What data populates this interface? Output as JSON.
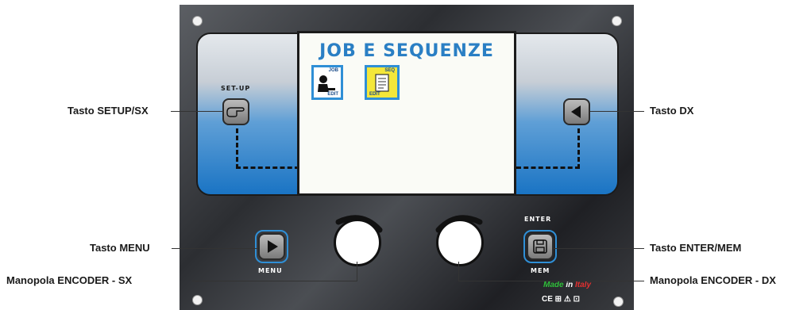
{
  "panel": {
    "display": {
      "title": "JOB E SEQUENZE",
      "icons": [
        {
          "name": "job-edit-icon",
          "tag_top": "JOB",
          "tag_bottom": "EDIT"
        },
        {
          "name": "seq-edit-icon",
          "tag_top": "SEQ",
          "tag_bottom": "EDIT"
        }
      ]
    },
    "setup_label": "SET-UP",
    "menu_label": "MENU",
    "enter_label": "ENTER",
    "mem_label": "MEM",
    "made_in_text": "Made",
    "made_in_word": "in",
    "made_in_country": "Italy",
    "cert_marks": "CE ⊞ ⚠ ⊡"
  },
  "callouts": {
    "setup_sx": "Tasto SETUP/SX",
    "dx": "Tasto DX",
    "menu": "Tasto MENU",
    "enter_mem": "Tasto ENTER/MEM",
    "encoder_sx": "Manopola ENCODER - SX",
    "encoder_dx": "Manopola ENCODER - DX"
  },
  "colors": {
    "accent_blue": "#2f8fd6",
    "title_blue": "#2a7fc4",
    "seq_icon_yellow": "#f4e73a",
    "made_green": "#2fbf3a",
    "italy_red": "#e53030"
  }
}
